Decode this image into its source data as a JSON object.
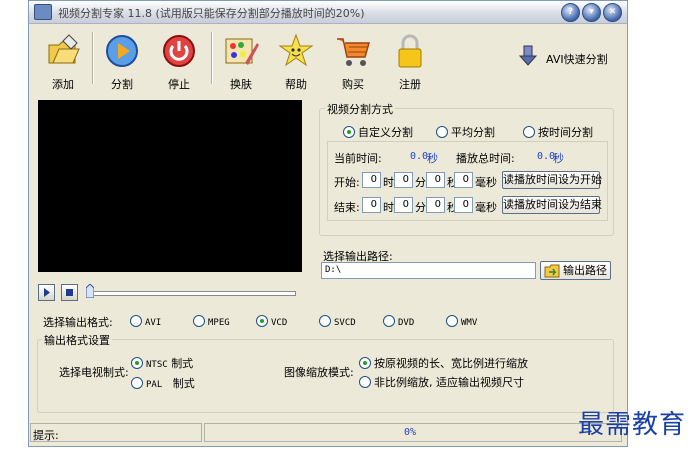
{
  "window": {
    "title": "视频分割专家 11.8 (试用版只能保存分割部分播放时间的20%)",
    "controls": {
      "help_glyph": "?",
      "minimize_glyph": "▾",
      "close_glyph": "✕"
    }
  },
  "toolbar": {
    "items": [
      {
        "label": "添加",
        "icon": "folder-add-icon"
      },
      {
        "label": "分割",
        "icon": "play-split-icon"
      },
      {
        "label": "停止",
        "icon": "stop-power-icon"
      },
      {
        "label": "换肤",
        "icon": "skin-palette-icon"
      },
      {
        "label": "帮助",
        "icon": "smiley-star-icon"
      },
      {
        "label": "购买",
        "icon": "shopping-cart-icon"
      },
      {
        "label": "注册",
        "icon": "padlock-icon"
      }
    ],
    "avi_fast": "AVI快速分割"
  },
  "split_mode": {
    "title": "视频分割方式",
    "options": [
      "自定义分割",
      "平均分割",
      "按时间分割"
    ],
    "selected": 0,
    "current_time_label": "当前时间:",
    "current_time_value": "0.0",
    "seconds": "秒",
    "total_time_label": "播放总时间:",
    "total_time_value": "0.0",
    "start_label": "开始:",
    "end_label": "结束:",
    "units": {
      "h": "时",
      "m": "分",
      "s": "秒",
      "ms": "毫秒"
    },
    "start_values": [
      "0",
      "0",
      "0",
      "0"
    ],
    "end_values": [
      "0",
      "0",
      "0",
      "0"
    ],
    "set_start_btn": "读播放时间设为开始",
    "set_end_btn": "读播放时间设为结束"
  },
  "output_path": {
    "label": "选择输出路径:",
    "value": "D:\\",
    "button": "输出路径"
  },
  "format": {
    "label": "选择输出格式:",
    "options": [
      "AVI",
      "MPEG",
      "VCD",
      "SVCD",
      "DVD",
      "WMV"
    ],
    "selected": 2
  },
  "output_settings": {
    "title": "输出格式设置",
    "tv_label": "选择电视制式:",
    "tv_options": [
      {
        "code": "NTSC",
        "suffix": "制式"
      },
      {
        "code": "PAL",
        "suffix": "制式"
      }
    ],
    "tv_selected": 0,
    "scale_label": "图像缩放模式:",
    "scale_options": [
      "按原视频的长、宽比例进行缩放",
      "非比例缩放, 适应输出视频尺寸"
    ],
    "scale_selected": 0
  },
  "status": {
    "hint_label": "提示:",
    "progress": "0%"
  },
  "watermark": "最需教育",
  "colors": {
    "accent": "#2044c0",
    "video_bg": "#000000",
    "window_bg": "#ece9d8"
  }
}
